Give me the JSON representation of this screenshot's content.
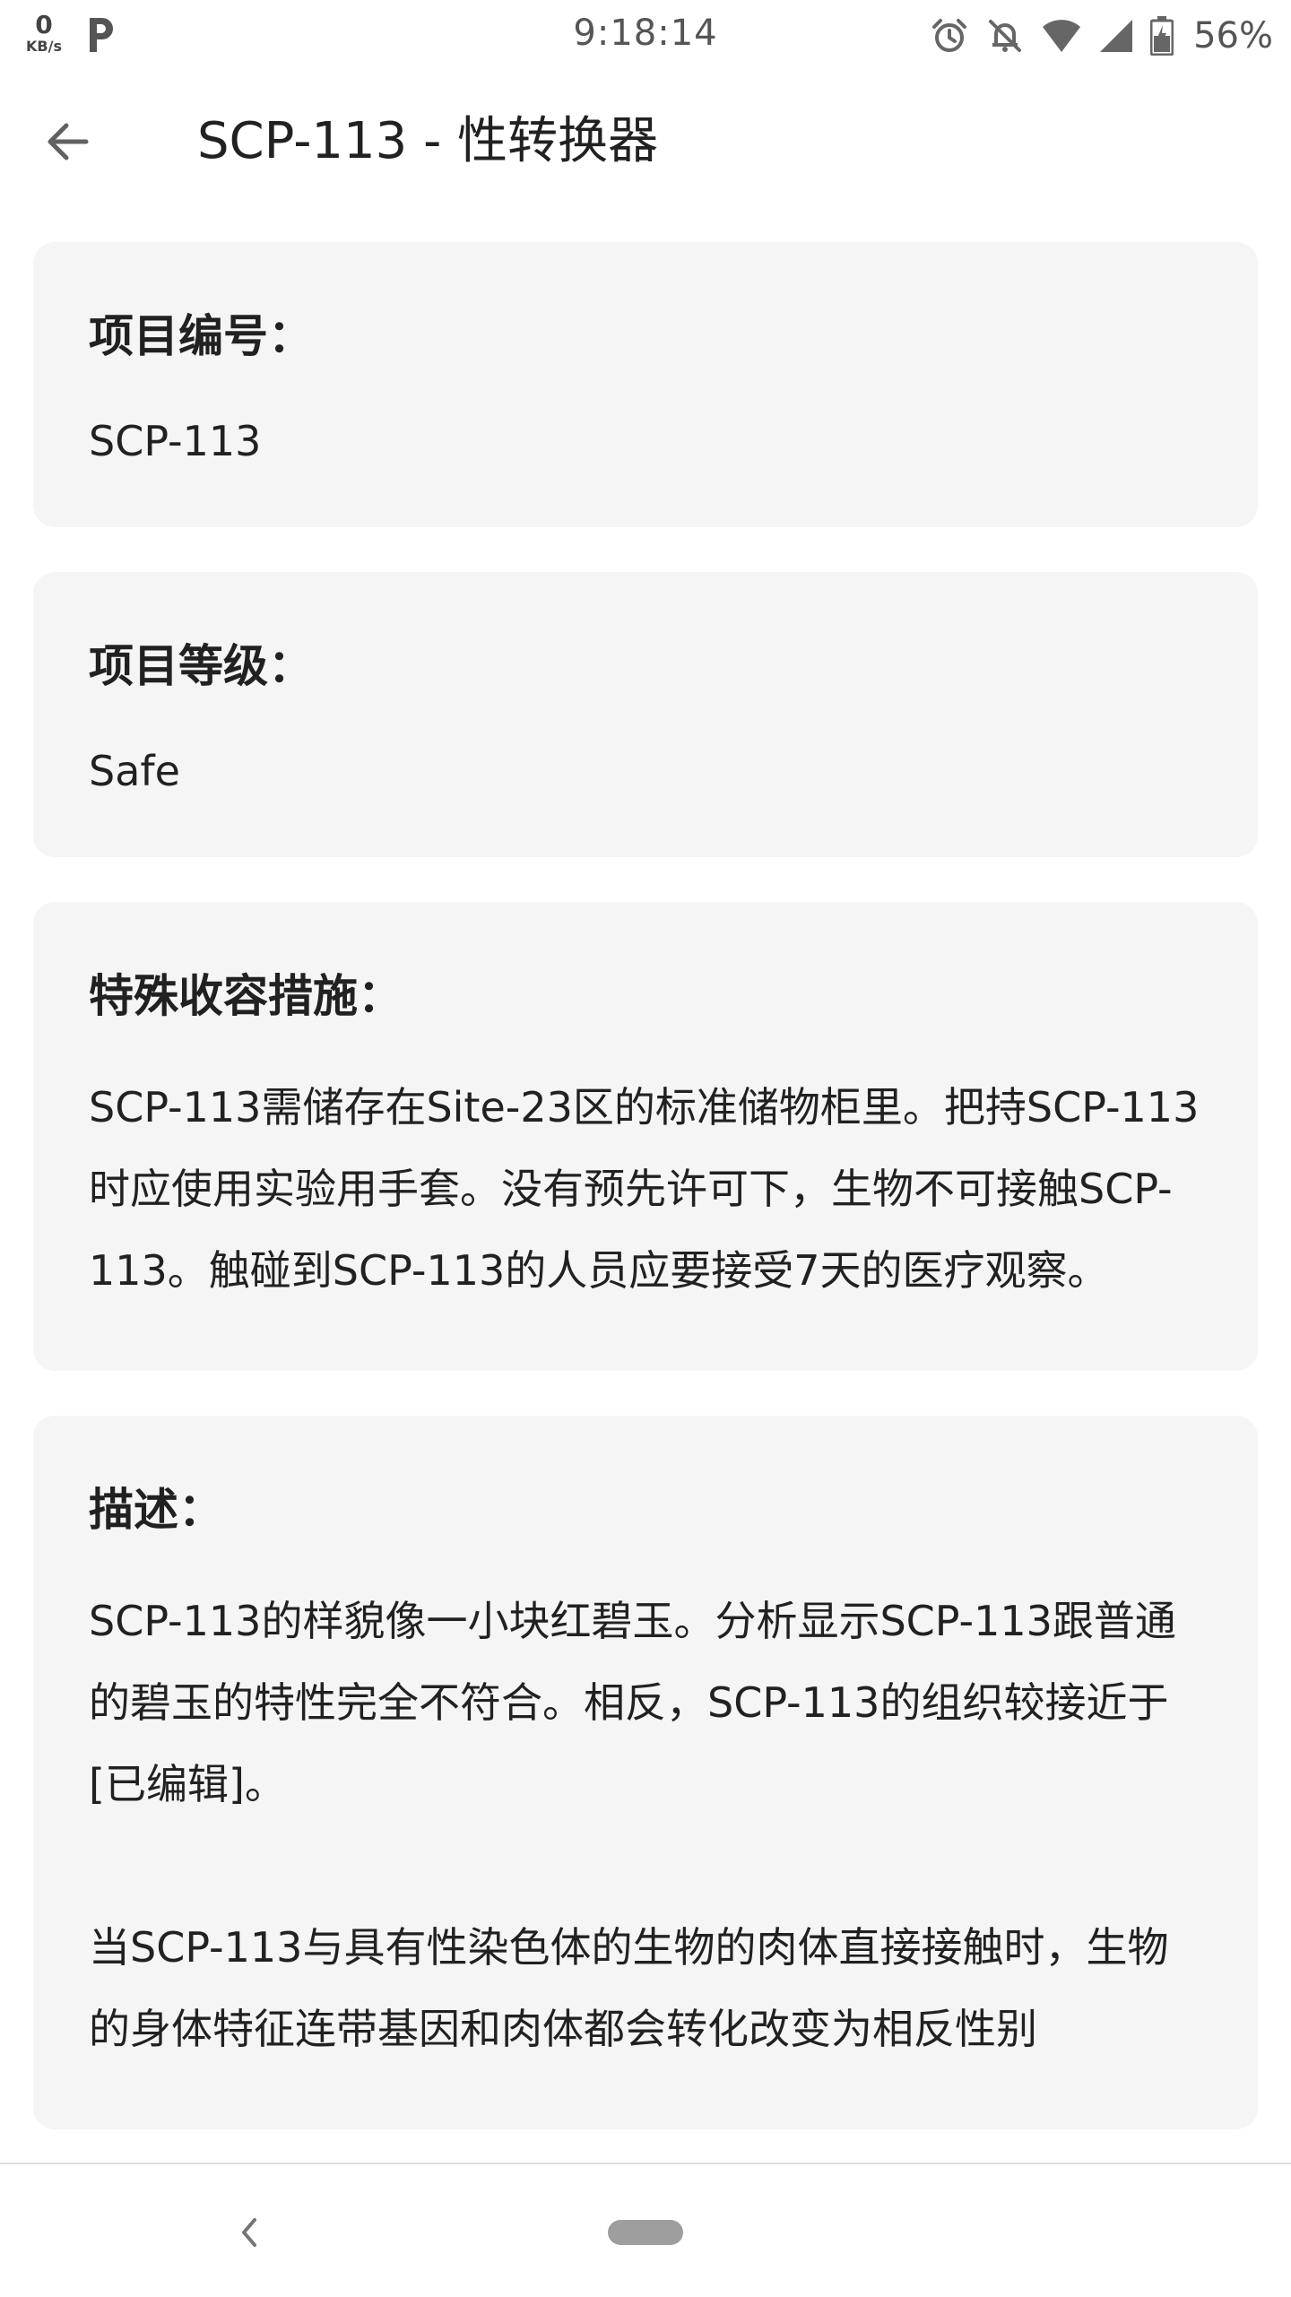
{
  "status_bar": {
    "net_speed_value": "0",
    "net_speed_unit": "KB/s",
    "time": "9:18:14",
    "battery_percent": "56%",
    "icons": [
      "p-app-icon",
      "alarm-icon",
      "notifications-off-icon",
      "wifi-icon",
      "cell-signal-icon",
      "battery-icon"
    ]
  },
  "app_bar": {
    "title": "SCP-113 - 性转换器",
    "back_icon": "arrow-left-icon"
  },
  "cards": {
    "item_number": {
      "heading": "项目编号：",
      "body": "SCP-113"
    },
    "object_class": {
      "heading": "项目等级：",
      "body": "Safe"
    },
    "containment": {
      "heading": "特殊收容措施：",
      "body": "SCP-113需储存在Site-23区的标准储物柜里。把持SCP-113时应使用实验用手套。没有预先许可下，生物不可接触SCP-113。触碰到SCP-113的人员应要接受7天的医疗观察。"
    },
    "description": {
      "heading": "描述：",
      "para1": "SCP-113的样貌像一小块红碧玉。分析显示SCP-113跟普通的碧玉的特性完全不符合。相反，SCP-113的组织较接近于[已编辑]。",
      "para2": "当SCP-113与具有性染色体的生物的肉体直接接触时，生物的身体特征连带基因和肉体都会转化改变为相反性别"
    }
  },
  "nav_bar": {
    "back_icon": "chevron-left-icon",
    "home_icon": "home-pill"
  },
  "colors": {
    "card_background": "#f5f5f5",
    "text_primary": "#212121",
    "status_text": "#555555"
  }
}
